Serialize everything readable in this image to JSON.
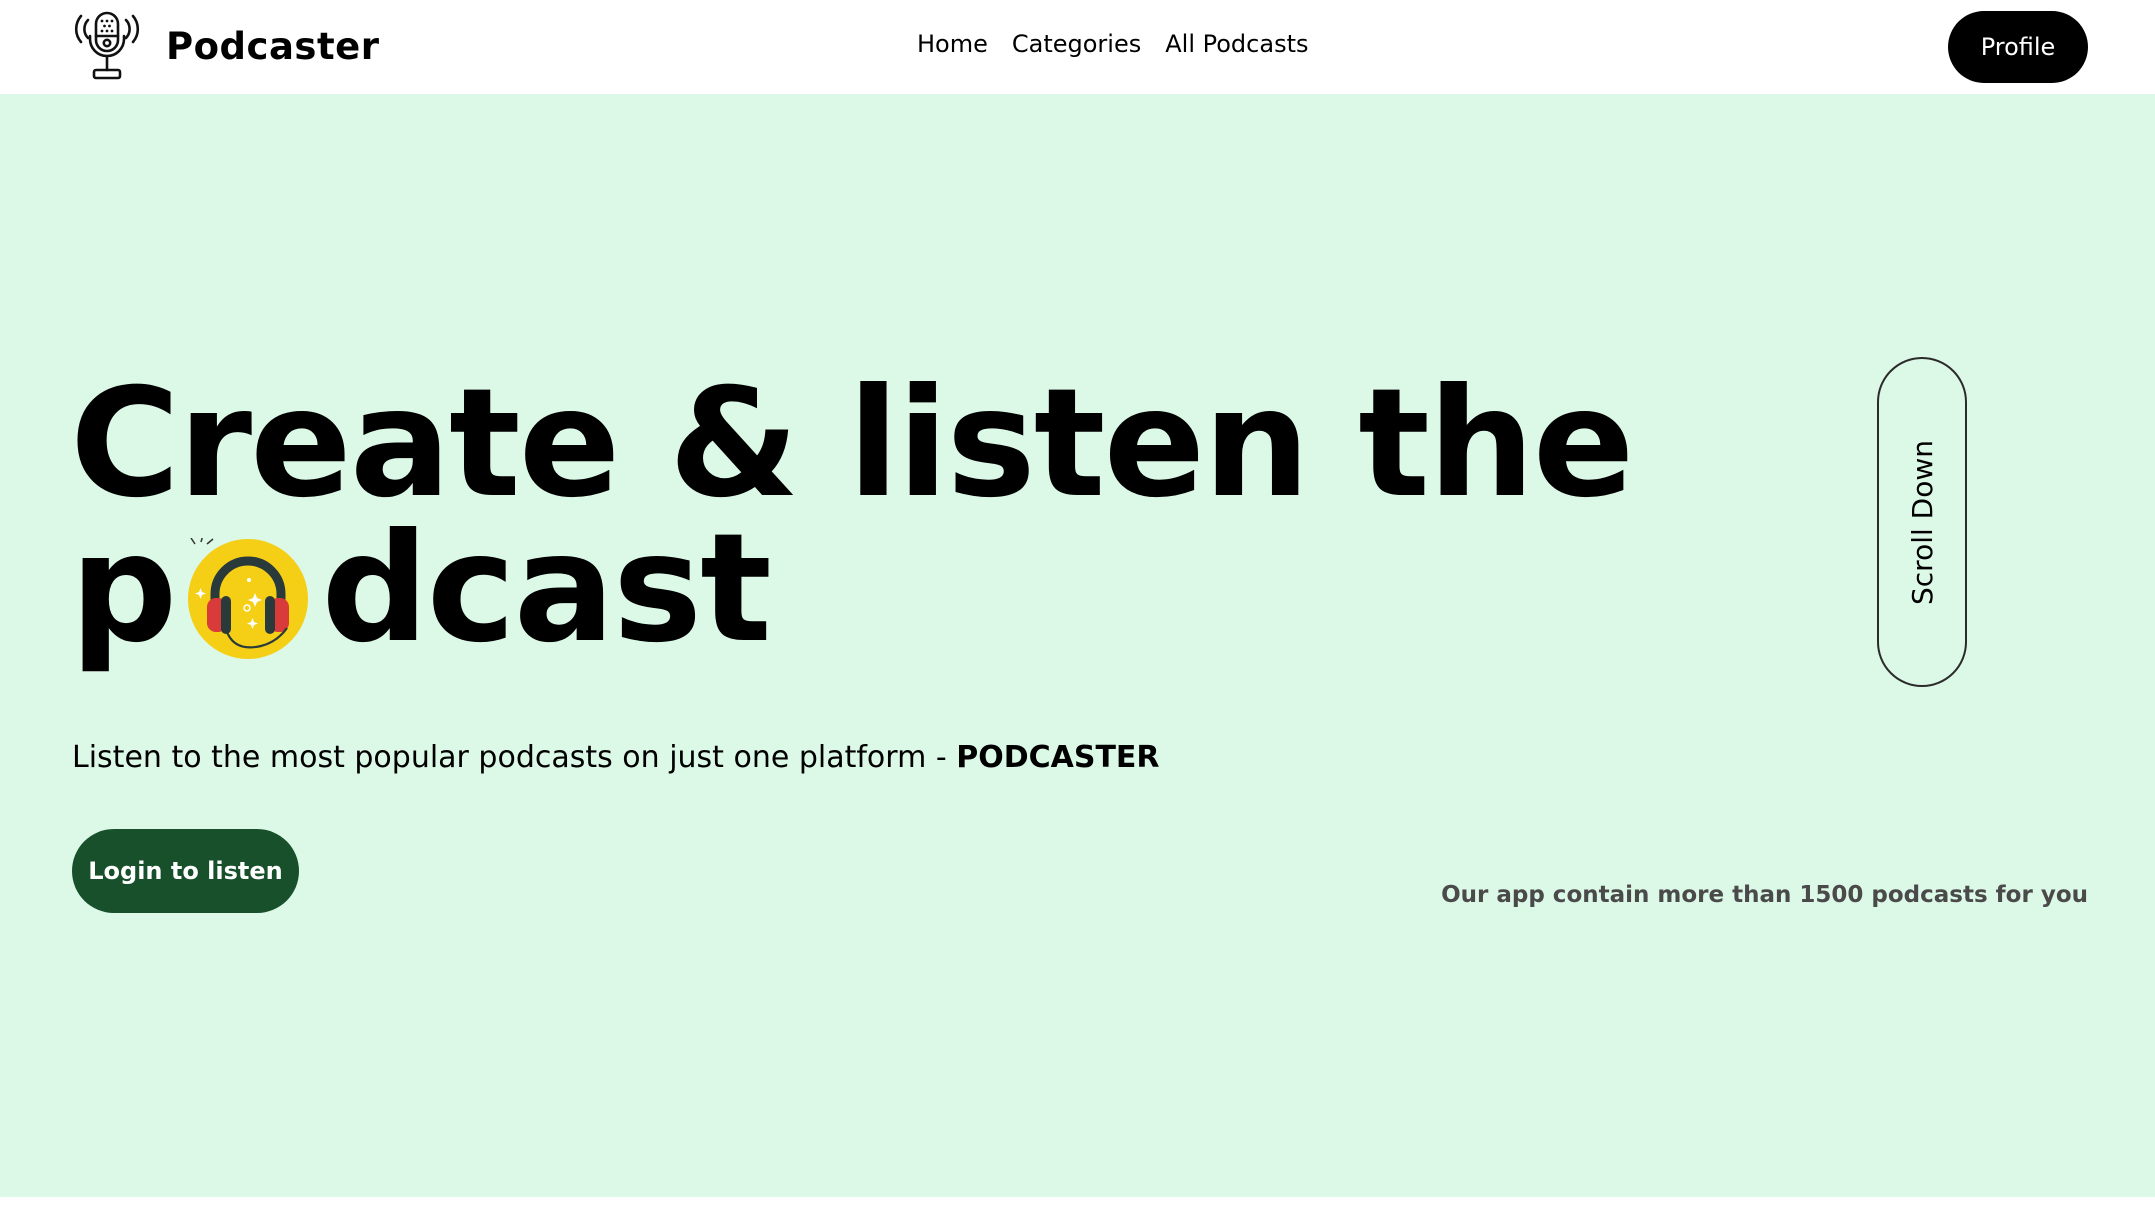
{
  "navbar": {
    "brand_name": "Podcaster",
    "logo_icon": "microphone-icon",
    "links": [
      "Home",
      "Categories",
      "All Podcasts"
    ],
    "profile_label": "Profile"
  },
  "hero": {
    "headline_line1": "Create & listen the",
    "headline_line2_start": "p",
    "headline_line2_end": "dcast",
    "headline_icon": "headphones-icon",
    "subtitle_text": "Listen to the most popular podcasts on just one platform - ",
    "subtitle_brand": "PODCASTER",
    "login_label": "Login to listen",
    "scroll_label": "Scroll Down",
    "stat_text": "Our app contain more than 1500 podcasts for you"
  },
  "colors": {
    "hero_background": "#dcf8e7",
    "login_button": "#17502b",
    "profile_button": "#000000",
    "badge_yellow": "#f5cf16"
  }
}
